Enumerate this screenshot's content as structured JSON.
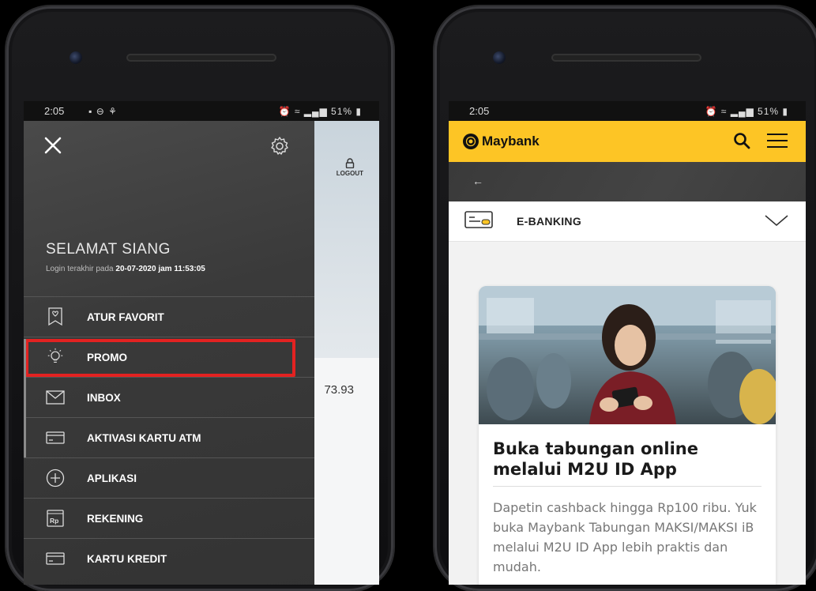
{
  "left_phone": {
    "status": {
      "time": "2:05",
      "battery": "51%"
    },
    "logout_label": "LOGOUT",
    "amount_partial": "73.93",
    "greeting": "SELAMAT SIANG",
    "last_login_prefix": "Login terakhir pada",
    "last_login_value": "20-07-2020 jam 11:53:05",
    "menu": [
      {
        "label": "ATUR FAVORIT",
        "icon": "bookmark-heart-icon"
      },
      {
        "label": "PROMO",
        "icon": "lightbulb-icon",
        "highlighted": true
      },
      {
        "label": "INBOX",
        "icon": "envelope-icon"
      },
      {
        "label": "AKTIVASI KARTU ATM",
        "icon": "card-icon"
      },
      {
        "label": "APLIKASI",
        "icon": "plus-circle-icon"
      },
      {
        "label": "REKENING",
        "icon": "rp-icon"
      },
      {
        "label": "KARTU KREDIT",
        "icon": "credit-card-icon"
      }
    ],
    "highlight_color": "#e32221"
  },
  "right_phone": {
    "status": {
      "time": "2:05",
      "battery": "51%"
    },
    "brand": "Maybank",
    "brand_color": "#fdc525",
    "back_glyph": "←",
    "section_label": "E-BANKING",
    "promo": {
      "title": "Buka tabungan online melalui M2U ID App",
      "description": "Dapetin cashback hingga Rp100 ribu. Yuk buka Maybank Tabungan MAKSI/MAKSI iB melalui M2U ID App lebih praktis dan mudah."
    }
  }
}
